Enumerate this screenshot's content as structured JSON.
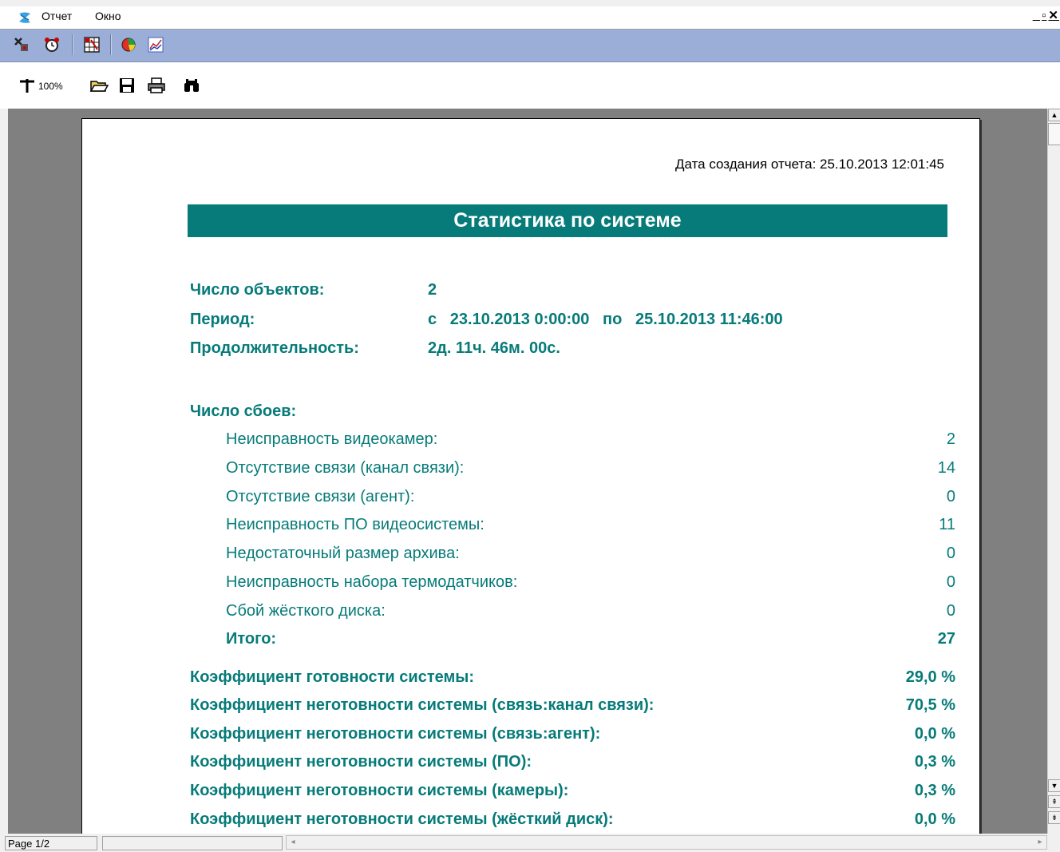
{
  "menubar": {
    "items": [
      "Отчет",
      "Окно"
    ]
  },
  "window_controls": {
    "minimize": "_",
    "restore": "▫",
    "close": "✕"
  },
  "toolbar2": {
    "zoom_label": "100%"
  },
  "report": {
    "created_label": "Дата создания отчета: 25.10.2013 12:01:45",
    "title": "Статистика по системе",
    "objects_label": "Число объектов:",
    "objects_value": "2",
    "period_label": "Период:",
    "period_value": "с   23.10.2013 0:00:00   по   25.10.2013 11:46:00",
    "duration_label": "Продолжительность:",
    "duration_value": "2д. 11ч. 46м. 00с.",
    "failures_label": "Число сбоев:",
    "failures": [
      {
        "label": "Неисправность видеокамер:",
        "value": "2"
      },
      {
        "label": "Отсутствие связи (канал связи):",
        "value": "14"
      },
      {
        "label": "Отсутствие связи (агент):",
        "value": "0"
      },
      {
        "label": "Неисправность ПО видеосистемы:",
        "value": "11"
      },
      {
        "label": "Недостаточный размер архива:",
        "value": "0"
      },
      {
        "label": "Неисправность набора термодатчиков:",
        "value": "0"
      },
      {
        "label": "Сбой жёсткого диска:",
        "value": "0"
      }
    ],
    "total_label": "Итого:",
    "total_value": "27",
    "coefficients": [
      {
        "label": "Коэффициент готовности системы:",
        "value": "29,0 %"
      },
      {
        "label": "Коэффициент неготовности системы (связь:канал связи):",
        "value": "70,5 %"
      },
      {
        "label": "Коэффициент неготовности системы (связь:агент):",
        "value": "0,0 %"
      },
      {
        "label": "Коэффициент неготовности системы (ПО):",
        "value": "0,3 %"
      },
      {
        "label": "Коэффициент неготовности системы (камеры):",
        "value": "0,3 %"
      },
      {
        "label": "Коэффициент неготовности системы (жёсткий диск):",
        "value": "0,0 %"
      }
    ]
  },
  "status": {
    "page": "Page 1/2"
  },
  "colors": {
    "accent": "#067b79",
    "toolbar_bg": "#9aaed8",
    "viewport_bg": "#808080"
  }
}
